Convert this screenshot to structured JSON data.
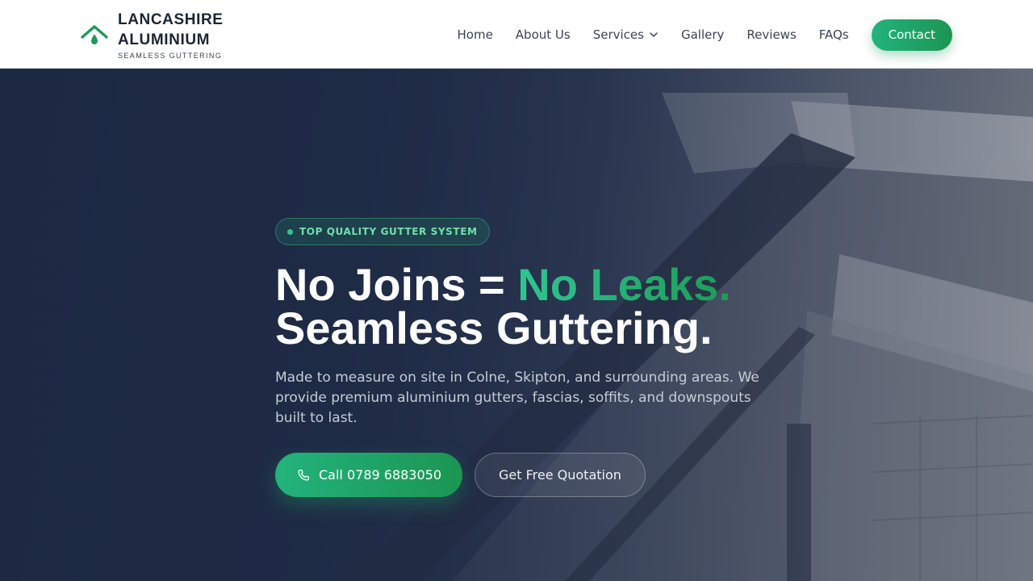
{
  "brand": {
    "line1": "LANCASHIRE",
    "line2": "ALUMINIUM",
    "tagline": "SEAMLESS GUTTERING",
    "icon": "roof-drop-icon",
    "accent_color": "#1f9a5a"
  },
  "nav": {
    "items": [
      {
        "label": "Home"
      },
      {
        "label": "About Us"
      },
      {
        "label": "Services",
        "icon": "chevron-down-icon"
      },
      {
        "label": "Gallery"
      },
      {
        "label": "Reviews"
      },
      {
        "label": "FAQs"
      }
    ],
    "contact_label": "Contact"
  },
  "hero": {
    "badge": "TOP QUALITY GUTTER SYSTEM",
    "headline_part1": "No Joins = ",
    "headline_accent": "No Leaks.",
    "headline_line2": "Seamless Guttering.",
    "description": "Made to measure on site in Colne, Skipton, and surrounding areas. We provide premium aluminium gutters, fascias, soffits, and downspouts built to last.",
    "call_label": "Call 0789 6883050",
    "call_icon": "phone-icon",
    "quote_label": "Get Free Quotation"
  },
  "colors": {
    "primary_green": "#22b37c",
    "dark_navy": "#1f2d45",
    "header_bg": "#ffffff"
  }
}
